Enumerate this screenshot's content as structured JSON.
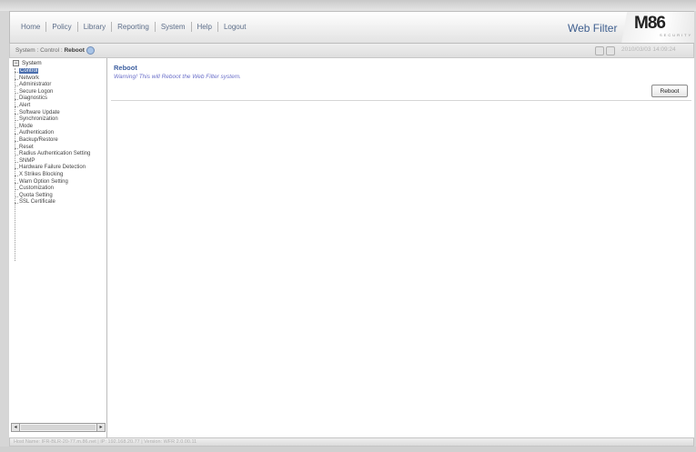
{
  "menu": {
    "items": [
      {
        "label": "Home"
      },
      {
        "label": "Policy"
      },
      {
        "label": "Library"
      },
      {
        "label": "Reporting"
      },
      {
        "label": "System"
      },
      {
        "label": "Help"
      },
      {
        "label": "Logout"
      }
    ]
  },
  "header": {
    "product": "Web Filter",
    "logo": "M86",
    "logo_sub": "SECURITY"
  },
  "breadcrumb": {
    "path": "System : Control : ",
    "current": "Reboot",
    "datetime": "2010/03/03 14:09:24"
  },
  "sidebar": {
    "root": "System",
    "items": [
      {
        "label": "Control",
        "selected": true
      },
      {
        "label": "Network"
      },
      {
        "label": "Administrator"
      },
      {
        "label": "Secure Logon"
      },
      {
        "label": "Diagnostics"
      },
      {
        "label": "Alert"
      },
      {
        "label": "Software Update"
      },
      {
        "label": "Synchronization"
      },
      {
        "label": "Mode"
      },
      {
        "label": "Authentication"
      },
      {
        "label": "Backup/Restore"
      },
      {
        "label": "Reset"
      },
      {
        "label": "Radius Authentication Setting"
      },
      {
        "label": "SNMP"
      },
      {
        "label": "Hardware Failure Detection"
      },
      {
        "label": "X Strikes Blocking"
      },
      {
        "label": "Warn Option Setting"
      },
      {
        "label": "Customization"
      },
      {
        "label": "Quota Setting"
      },
      {
        "label": "SSL Certificate"
      }
    ]
  },
  "panel": {
    "title": "Reboot",
    "warning": "Warning! This will Reboot the Web Filter system.",
    "button": "Reboot"
  },
  "status": {
    "text": "Host Name: IFR-BLR-20-77.m.86.net  |  IP: 192.168.20.77  |  Version: WFR 2.0.00.11"
  },
  "icons": {
    "help": "help-icon",
    "scroll_left": "scroll-left-icon",
    "scroll_right": "scroll-right-icon"
  },
  "colors": {
    "accent": "#3d5fa0",
    "selected": "#4b6fae",
    "warning": "#6a6fc9"
  }
}
